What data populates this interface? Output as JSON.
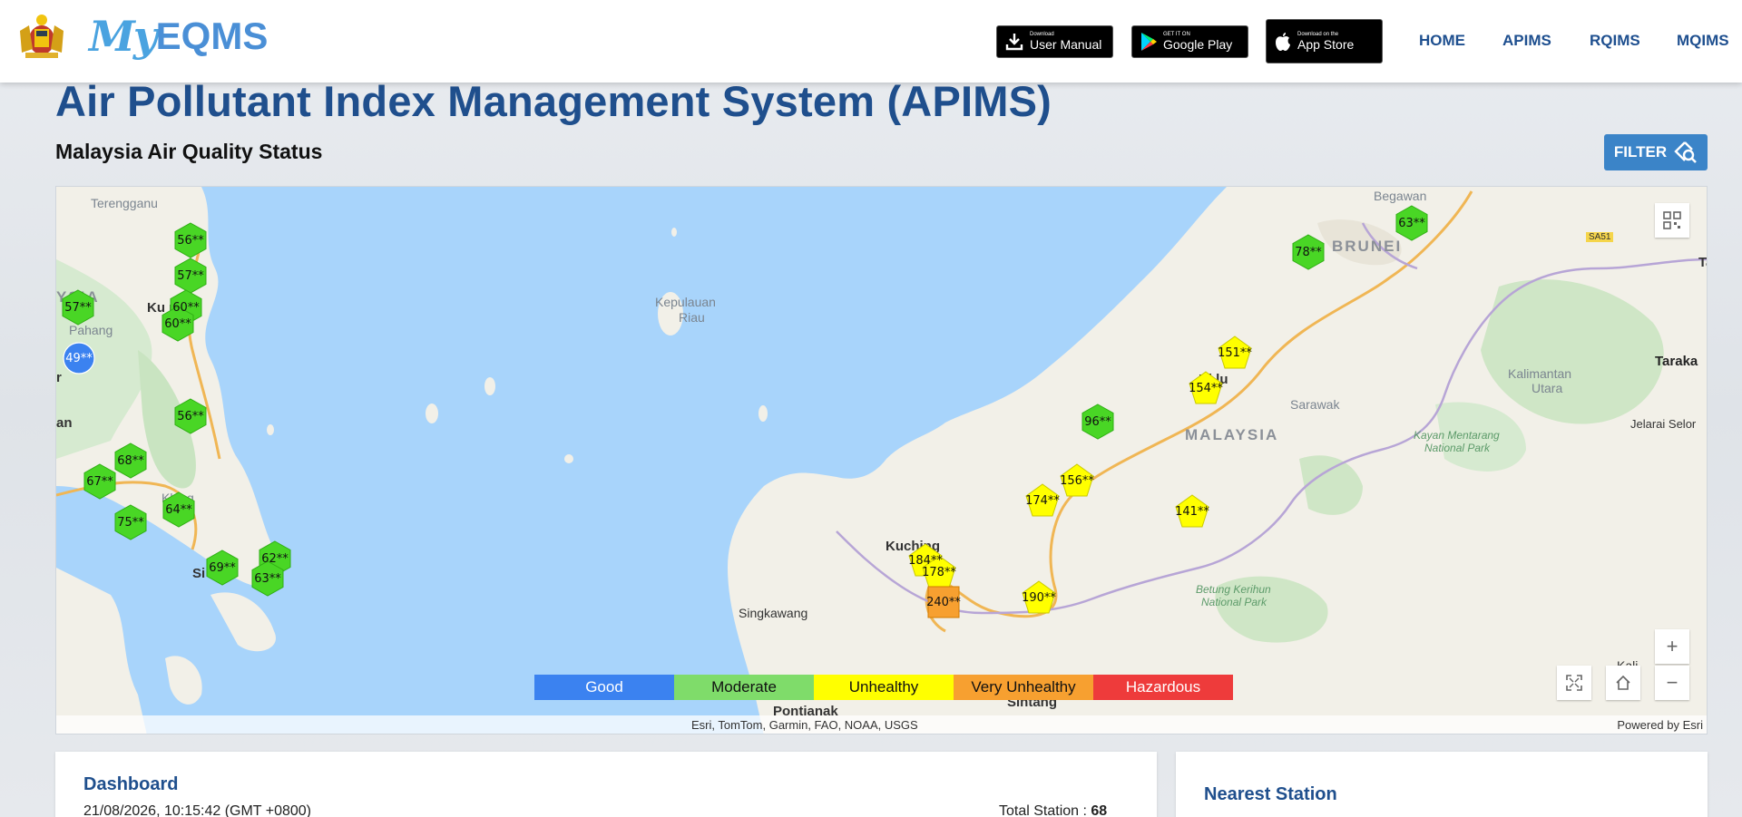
{
  "header": {
    "brand_my": "My",
    "brand_eqms": "EQMS",
    "download_manual": {
      "small": "Download",
      "big": "User Manual"
    },
    "google_play": {
      "small": "GET IT ON",
      "big": "Google Play"
    },
    "app_store": {
      "small": "Download on the",
      "big": "App Store"
    },
    "nav": [
      "HOME",
      "APIMS",
      "RQIMS",
      "MQIMS"
    ]
  },
  "page": {
    "title": "Air Pollutant Index Management System (APIMS)",
    "subtitle": "Malaysia Air Quality Status",
    "filter_label": "FILTER"
  },
  "map": {
    "labels": {
      "terengganu": "Terengganu",
      "begawan": "Begawan",
      "brunei": "BRUNEI",
      "ysia": "YSIA",
      "pahang": "Pahang",
      "kuantan": "Ku     n",
      "kepulauan": "Kepulauan",
      "riau": "Riau",
      "bintulu": "Bi    lu",
      "sarawak": "Sarawak",
      "malaysia": "MALAYSIA",
      "kalimantan": "Kalimantan",
      "utara": "Utara",
      "tarakan": "Taraka",
      "jelarai": "Jelarai Selor",
      "kayan1": "Kayan Mentarang",
      "kayan2": "National Park",
      "betung1": "Betung Kerihun",
      "betung2": "National Park",
      "kuching": "Kuching",
      "singkawang": "Singkawang",
      "pontianak": "Pontianak",
      "sintang": "Sintang",
      "kali": "Kali",
      "t": "T",
      "klang": "Klang",
      "si": "Si",
      "r": "r",
      "an": "an",
      "ta": "Ta",
      "road_sign": "SA51"
    },
    "stations": [
      {
        "api": "56**",
        "level": "Moderate"
      },
      {
        "api": "57**",
        "level": "Moderate"
      },
      {
        "api": "60**",
        "level": "Moderate"
      },
      {
        "api": "60**",
        "level": "Moderate"
      },
      {
        "api": "57**",
        "level": "Moderate"
      },
      {
        "api": "49**",
        "level": "Good"
      },
      {
        "api": "56**",
        "level": "Moderate"
      },
      {
        "api": "68**",
        "level": "Moderate"
      },
      {
        "api": "67**",
        "level": "Moderate"
      },
      {
        "api": "64**",
        "level": "Moderate"
      },
      {
        "api": "75**",
        "level": "Moderate"
      },
      {
        "api": "62**",
        "level": "Moderate"
      },
      {
        "api": "69**",
        "level": "Moderate"
      },
      {
        "api": "63**",
        "level": "Moderate"
      },
      {
        "api": "63**",
        "level": "Moderate"
      },
      {
        "api": "78**",
        "level": "Moderate"
      },
      {
        "api": "151**",
        "level": "Unhealthy"
      },
      {
        "api": "154**",
        "level": "Unhealthy"
      },
      {
        "api": "96**",
        "level": "Moderate"
      },
      {
        "api": "156**",
        "level": "Unhealthy"
      },
      {
        "api": "174**",
        "level": "Unhealthy"
      },
      {
        "api": "141**",
        "level": "Unhealthy"
      },
      {
        "api": "184**",
        "level": "Unhealthy"
      },
      {
        "api": "178**",
        "level": "Unhealthy"
      },
      {
        "api": "240**",
        "level": "Very Unhealthy"
      },
      {
        "api": "190**",
        "level": "Unhealthy"
      }
    ],
    "legend": [
      {
        "label": "Good",
        "color": "#3b82f0",
        "text": "#ffffff"
      },
      {
        "label": "Moderate",
        "color": "#7fdc6a",
        "text": "#111111"
      },
      {
        "label": "Unhealthy",
        "color": "#ffff00",
        "text": "#111111"
      },
      {
        "label": "Very Unhealthy",
        "color": "#f7a030",
        "text": "#111111"
      },
      {
        "label": "Hazardous",
        "color": "#ee3b3b",
        "text": "#ffffff"
      }
    ],
    "attribution": "Esri, TomTom, Garmin, FAO, NOAA, USGS",
    "powered_by": "Powered by Esri"
  },
  "dashboard": {
    "title": "Dashboard",
    "datetime": "21/08/2026, 10:15:42 (GMT +0800)",
    "total_label": "Total Station :",
    "total_value": "68"
  },
  "nearest": {
    "title": "Nearest Station"
  }
}
